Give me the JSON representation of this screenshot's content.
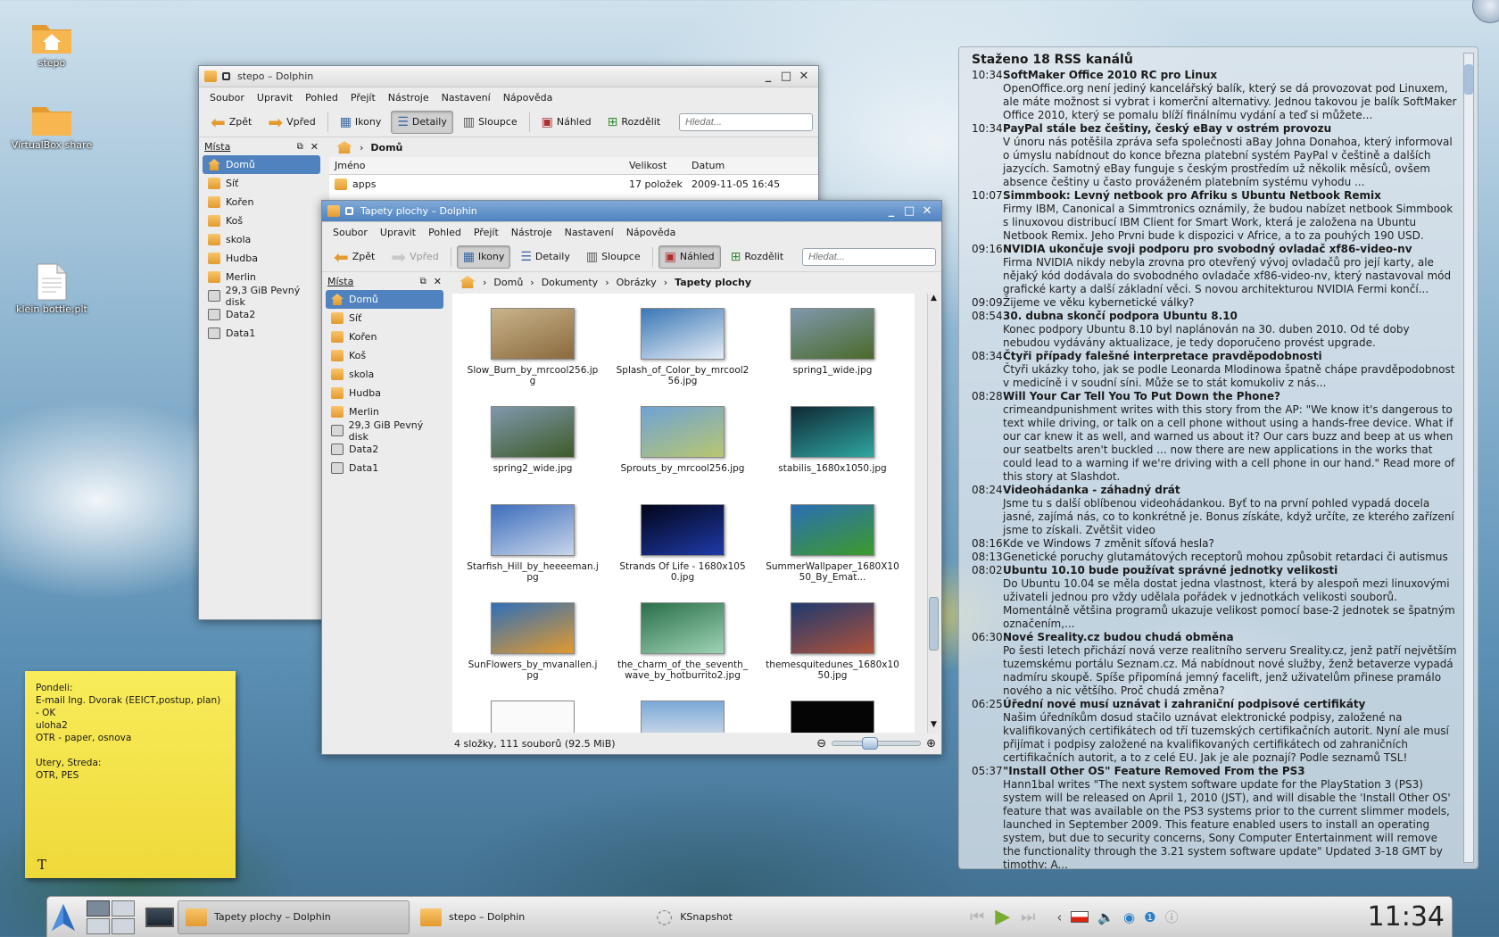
{
  "desktop": {
    "icons": [
      {
        "label": "stepo",
        "icon": "home-folder-icon"
      },
      {
        "label": "VirtualBox share",
        "icon": "folder-icon"
      },
      {
        "label": "klein bottle.plt",
        "icon": "document-icon"
      }
    ]
  },
  "sticky_note": {
    "lines": [
      "Pondeli:",
      "E-mail Ing. Dvorak (EEICT,postup, plan) - OK",
      "uloha2",
      "OTR - paper, osnova",
      "",
      "Utery, Streda:",
      "OTR, PES"
    ],
    "icon": "T"
  },
  "dolphin_back": {
    "title": "stepo – Dolphin",
    "menu": [
      "Soubor",
      "Upravit",
      "Pohled",
      "Přejít",
      "Nástroje",
      "Nastavení",
      "Nápověda"
    ],
    "toolbar": {
      "back": "Zpět",
      "forward": "Vpřed",
      "icons": "Ikony",
      "details": "Detaily",
      "columns": "Sloupce",
      "preview": "Náhled",
      "split": "Rozdělit",
      "search_placeholder": "Hledat..."
    },
    "places_title": "Místa",
    "places": [
      "Domů",
      "Síť",
      "Kořen",
      "Koš",
      "skola",
      "Hudba",
      "Merlin",
      "29,3 GiB Pevný disk",
      "Data2",
      "Data1"
    ],
    "breadcrumb": "Domů",
    "columns": {
      "name": "Jméno",
      "size": "Velikost",
      "date": "Datum"
    },
    "rows": [
      {
        "name": "apps",
        "size": "17 položek",
        "date": "2009-11-05 16:45"
      }
    ]
  },
  "dolphin_front": {
    "title": "Tapety plochy – Dolphin",
    "menu": [
      "Soubor",
      "Upravit",
      "Pohled",
      "Přejít",
      "Nástroje",
      "Nastavení",
      "Nápověda"
    ],
    "toolbar": {
      "back": "Zpět",
      "forward": "Vpřed",
      "icons": "Ikony",
      "details": "Detaily",
      "columns": "Sloupce",
      "preview": "Náhled",
      "split": "Rozdělit",
      "search_placeholder": "Hledat..."
    },
    "places_title": "Místa",
    "places": [
      "Domů",
      "Síť",
      "Kořen",
      "Koš",
      "skola",
      "Hudba",
      "Merlin",
      "29,3 GiB Pevný disk",
      "Data2",
      "Data1"
    ],
    "breadcrumb": [
      "Domů",
      "Dokumenty",
      "Obrázky",
      "Tapety plochy"
    ],
    "files": [
      {
        "name": "Slow_Burn_by_mrcool256.jpg",
        "colors": [
          "#c9b38a",
          "#8a6a3e"
        ]
      },
      {
        "name": "Splash_of_Color_by_mrcool256.jpg",
        "colors": [
          "#3a77b5",
          "#e6eef6"
        ]
      },
      {
        "name": "spring1_wide.jpg",
        "colors": [
          "#7f98ad",
          "#4a6a2a"
        ]
      },
      {
        "name": "spring2_wide.jpg",
        "colors": [
          "#7f98ad",
          "#3d5b28"
        ]
      },
      {
        "name": "Sprouts_by_mrcool256.jpg",
        "colors": [
          "#6fa2d6",
          "#b8c770"
        ]
      },
      {
        "name": "stabilis_1680x1050.jpg",
        "colors": [
          "#0f2a36",
          "#2fa6a0"
        ]
      },
      {
        "name": "Starfish_Hill_by_heeeeman.jpg",
        "colors": [
          "#3e6ebd",
          "#c8d6ea"
        ]
      },
      {
        "name": "Strands Of Life - 1680x1050.jpg",
        "colors": [
          "#02051a",
          "#1f3aa8"
        ]
      },
      {
        "name": "SummerWallpaper_1680X1050_By_Emat...",
        "colors": [
          "#2a6fb5",
          "#3d9a2a"
        ]
      },
      {
        "name": "SunFlowers_by_mvanallen.jpg",
        "colors": [
          "#2f6fb8",
          "#e39a2e"
        ]
      },
      {
        "name": "the_charm_of_the_seventh_wave_by_hotburrito2.jpg",
        "colors": [
          "#2a6f4a",
          "#9ed3b5"
        ]
      },
      {
        "name": "themesquitedunes_1680x1050.jpg",
        "colors": [
          "#1e3a6f",
          "#b0523a"
        ]
      }
    ],
    "status": "4 složky, 111 souborů (92.5 MiB)",
    "zoom_level": 0.4
  },
  "rss": {
    "title": "Staženo 18 RSS kanálů",
    "items": [
      {
        "time": "10:34",
        "headline": "SoftMaker Office 2010 RC pro Linux",
        "bold": true,
        "desc": "OpenOffice.org není jediný kancelářský balík, který se dá provozovat pod Linuxem, ale máte možnost si vybrat i komerční alternativy. Jednou takovou je balík SoftMaker Office 2010, který se pomalu blíží finálnímu vydání a teď si můžete..."
      },
      {
        "time": "10:34",
        "headline": "PayPal stále bez češtiny, český eBay v ostrém provozu",
        "bold": true,
        "desc": "V únoru nás potěšila zpráva sefa společnosti aBay Johna Donahoa, který informoval o úmyslu nabídnout do konce března platební systém PayPal v češtině a dalších jazycích. Samotný eBay funguje s českým prostředím už několik měsíců, ovšem absence češtiny u často prováženém platebním systému vyhodu ..."
      },
      {
        "time": "10:07",
        "headline": "Simmbook: Levný netbook pro Afriku s Ubuntu Netbook Remix",
        "bold": true,
        "desc": "Firmy IBM, Canonical a Simmtronics oznámily, že budou nabízet netbook Simmbook s linuxovou distribucí IBM Client for Smart Work, která je založena na Ubuntu Netbook Remix. Jeho Prvni bude k dispozici v Africe, a to za pouhých 190 USD."
      },
      {
        "time": "09:16",
        "headline": "NVIDIA ukončuje svoji podporu pro svobodný ovladač xf86-video-nv",
        "bold": true,
        "desc": "Firma NVIDIA nikdy nebyla zrovna pro otevřený vývoj ovladačů pro její karty, ale nějaký kód dodávala do svobodného ovladače xf86-video-nv, který nastavoval mód grafické karty a další základní věci. S novou architekturou NVIDIA Fermi končí..."
      },
      {
        "time": "09:09",
        "headline": "Žijeme ve věku kybernetické války?",
        "bold": false,
        "desc": ""
      },
      {
        "time": "08:54",
        "headline": "30. dubna skončí podpora Ubuntu 8.10",
        "bold": true,
        "desc": "Konec podpory Ubuntu 8.10 byl naplánován na 30. duben 2010. Od té doby nebudou vydávány aktualizace, je tedy doporučeno provést upgrade."
      },
      {
        "time": "08:34",
        "headline": "Čtyři případy falešné interpretace pravděpodobnosti",
        "bold": true,
        "desc": "Čtyři ukázky toho, jak se podle Leonarda Mlodinowa špatně chápe pravděpodobnost v medicíně i v soudní síni. Může se to stát komukoliv z nás..."
      },
      {
        "time": "08:28",
        "headline": "Will Your Car Tell You To Put Down the Phone?",
        "bold": true,
        "desc": "crimeandpunishment writes with this story from the AP: \"We know it's dangerous to text while driving, or talk on a cell phone without using a hands-free device. What if our car knew it as well, and warned us about it? Our cars buzz and beep at us when our seatbelts aren't buckled ... now there are new applications in the works that could lead to a warning if we're driving with a cell phone in our hand.\" Read more of this story at Slashdot."
      },
      {
        "time": "08:24",
        "headline": "Videohádanka - záhadný drát",
        "bold": true,
        "desc": "Jsme tu s další oblíbenou videohádankou. Byť to na první pohled vypadá docela jasné, zajímá nás, co to konkrétně je. Bonus získáte, když určíte, ze kterého zařízení jsme to získali. Zvětšit video"
      },
      {
        "time": "08:16",
        "headline": "Kde ve Windows 7 změnit síťová hesla?",
        "bold": false,
        "desc": ""
      },
      {
        "time": "08:13",
        "headline": "Genetické poruchy glutamátových receptorů mohou způsobit retardaci či autismus",
        "bold": false,
        "desc": ""
      },
      {
        "time": "08:02",
        "headline": "Ubuntu 10.10 bude používat správné jednotky velikosti",
        "bold": true,
        "desc": "Do Ubuntu 10.04 se měla dostat jedna vlastnost, která by alespoň mezi linuxovými uživateli jednou pro vždy udělala pořádek v jednotkách velikosti souborů. Momentálně většina programů ukazuje velikost pomocí base-2 jednotek se špatným označením,..."
      },
      {
        "time": "06:30",
        "headline": "Nové Sreality.cz budou chudá obměna",
        "bold": true,
        "desc": "Po šesti letech přichází nová verze realitního serveru Sreality.cz, jenž patří největším tuzemskému portálu Seznam.cz. Má nabídnout nové služby, ženž betaverze vypadá nadmíru skoupě. Spíše připomíná jemný facelift, jenž uživatelům přinese pramálo nového a nic většího. Proč chudá změna?"
      },
      {
        "time": "06:25",
        "headline": "Úřední nové musí uznávat i zahraniční podpisové certifikáty",
        "bold": true,
        "desc": "Našim úředníkům dosud stačilo uznávat elektronické podpisy, založené na kvalifikovaných certifikátech od tří tuzemských certifikačních autorit. Nyní ale musí přijímat i podpisy založené na kvalifikovaných certifikátech od zahraničních certifikačních autorit, a to z celé EU. Jak je ale poznají? Podle seznamů TSL!"
      },
      {
        "time": "05:37",
        "headline": "\"Install Other OS\" Feature Removed From the PS3",
        "bold": true,
        "desc": "Hann1bal writes \"The next system software update for the PlayStation 3 (PS3) system will be released on April 1, 2010 (JST), and will disable the 'Install Other OS' feature that was available on the PS3 systems prior to the current slimmer models, launched in September 2009. This feature enabled users to install an operating system, but due to security concerns, Sony Computer Entertainment will remove the functionality through the 3.21 system software update\" Updated 3-18 GMT by timothy: A..."
      }
    ]
  },
  "taskbar": {
    "tasks": [
      {
        "label": "Tapety plochy – Dolphin",
        "active": true
      },
      {
        "label": "stepo – Dolphin",
        "active": false
      },
      {
        "label": "KSnapshot",
        "active": false
      }
    ],
    "clock": "11:34"
  },
  "colors": {
    "accent": "#4f82bf",
    "sticky": "#f7e84a"
  }
}
